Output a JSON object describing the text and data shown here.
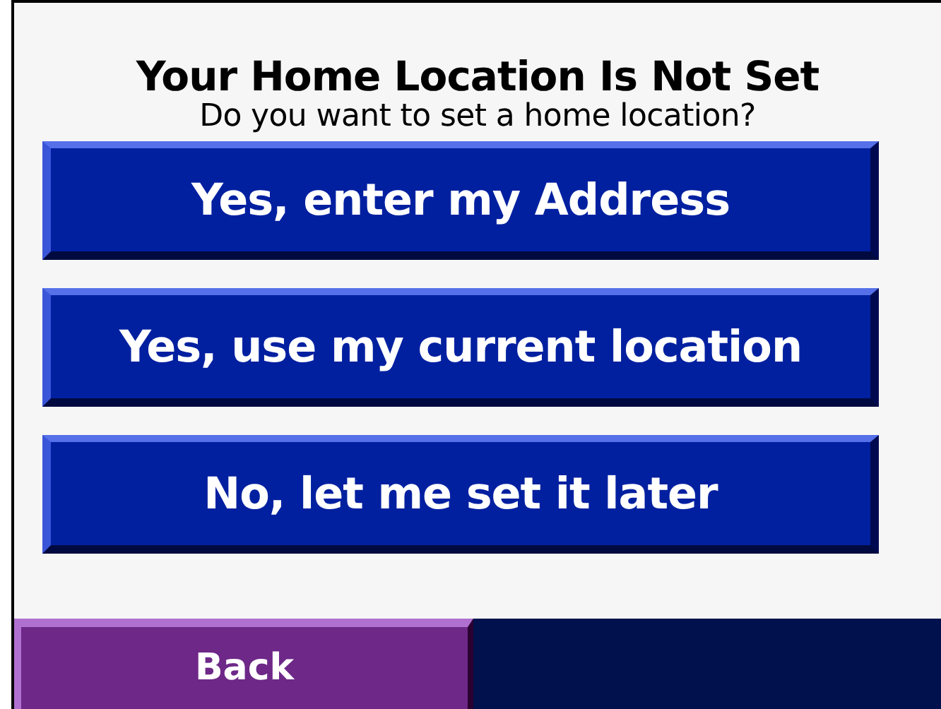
{
  "title": "Your Home Location Is Not Set",
  "subtitle": "Do you want to set a home location?",
  "options": [
    "Yes, enter my Address",
    "Yes, use my current location",
    "No, let me set it later"
  ],
  "back": "Back"
}
